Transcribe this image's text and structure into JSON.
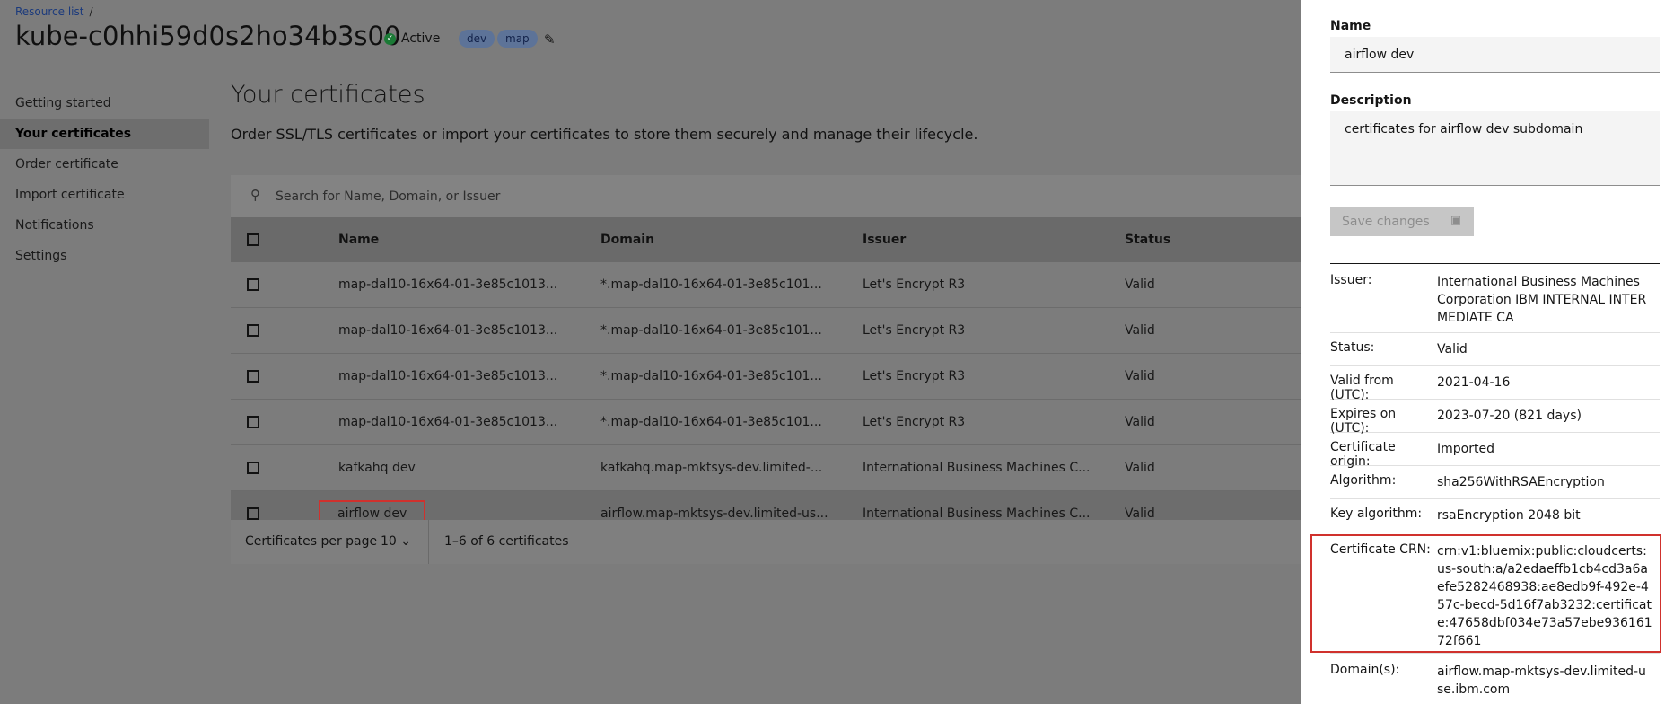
{
  "breadcrumb": {
    "link": "Resource list",
    "separator": "/"
  },
  "instance": {
    "title": "kube-c0hhi59d0s2ho34b3s00",
    "status": "Active",
    "tags": [
      "dev",
      "map"
    ]
  },
  "side_nav": {
    "items": [
      {
        "label": "Getting started"
      },
      {
        "label": "Your certificates"
      },
      {
        "label": "Order certificate"
      },
      {
        "label": "Import certificate"
      },
      {
        "label": "Notifications"
      },
      {
        "label": "Settings"
      }
    ]
  },
  "main": {
    "title": "Your certificates",
    "description": "Order SSL/TLS certificates or import your certificates to store them securely and manage their lifecycle.",
    "search_placeholder": "Search for Name, Domain, or Issuer"
  },
  "table": {
    "headers": {
      "name": "Name",
      "domain": "Domain",
      "issuer": "Issuer",
      "status": "Status"
    },
    "rows": [
      {
        "name": "map-dal10-16x64-01-3e85c1013...",
        "domain": "*.map-dal10-16x64-01-3e85c101...",
        "issuer": "Let's Encrypt R3",
        "status": "Valid"
      },
      {
        "name": "map-dal10-16x64-01-3e85c1013...",
        "domain": "*.map-dal10-16x64-01-3e85c101...",
        "issuer": "Let's Encrypt R3",
        "status": "Valid"
      },
      {
        "name": "map-dal10-16x64-01-3e85c1013...",
        "domain": "*.map-dal10-16x64-01-3e85c101...",
        "issuer": "Let's Encrypt R3",
        "status": "Valid"
      },
      {
        "name": "map-dal10-16x64-01-3e85c1013...",
        "domain": "*.map-dal10-16x64-01-3e85c101...",
        "issuer": "Let's Encrypt R3",
        "status": "Valid"
      },
      {
        "name": "kafkahq dev",
        "domain": "kafkahq.map-mktsys-dev.limited-...",
        "issuer": "International Business Machines C...",
        "status": "Valid"
      },
      {
        "name": "airflow dev",
        "domain": "airflow.map-mktsys-dev.limited-us...",
        "issuer": "International Business Machines C...",
        "status": "Valid"
      }
    ]
  },
  "pagination": {
    "per_page_label": "Certificates per page",
    "per_page_value": "10",
    "range": "1–6 of 6 certificates"
  },
  "panel": {
    "name_label": "Name",
    "name_value": "airflow dev",
    "description_label": "Description",
    "description_value": "certificates for airflow dev subdomain",
    "save_label": "Save changes",
    "details": [
      {
        "key": "Issuer:",
        "value": "International Business Machines Corporation IBM INTERNAL INTERMEDIATE CA"
      },
      {
        "key": "Status:",
        "value": "Valid"
      },
      {
        "key": "Valid from (UTC):",
        "value": "2021-04-16"
      },
      {
        "key": "Expires on (UTC):",
        "value": "2023-07-20 (821 days)"
      },
      {
        "key": "Certificate origin:",
        "value": "Imported"
      },
      {
        "key": "Algorithm:",
        "value": "sha256WithRSAEncryption"
      },
      {
        "key": "Key algorithm:",
        "value": "rsaEncryption 2048 bit"
      },
      {
        "key": "Certificate CRN:",
        "value": "crn:v1:bluemix:public:cloudcerts:us-south:a/a2edaeffb1cb4cd3a6aefe5282468938:ae8edb9f-492e-457c-becd-5d16f7ab3232:certificate:47658dbf034e73a57ebe93616172f661"
      },
      {
        "key": "Domain(s):",
        "value": "airflow.map-mktsys-dev.limited-use.ibm.com"
      }
    ]
  },
  "colors": {
    "highlight": "#d0312d",
    "status_active": "#1b7a36",
    "tag_bg": "#5d7398"
  }
}
